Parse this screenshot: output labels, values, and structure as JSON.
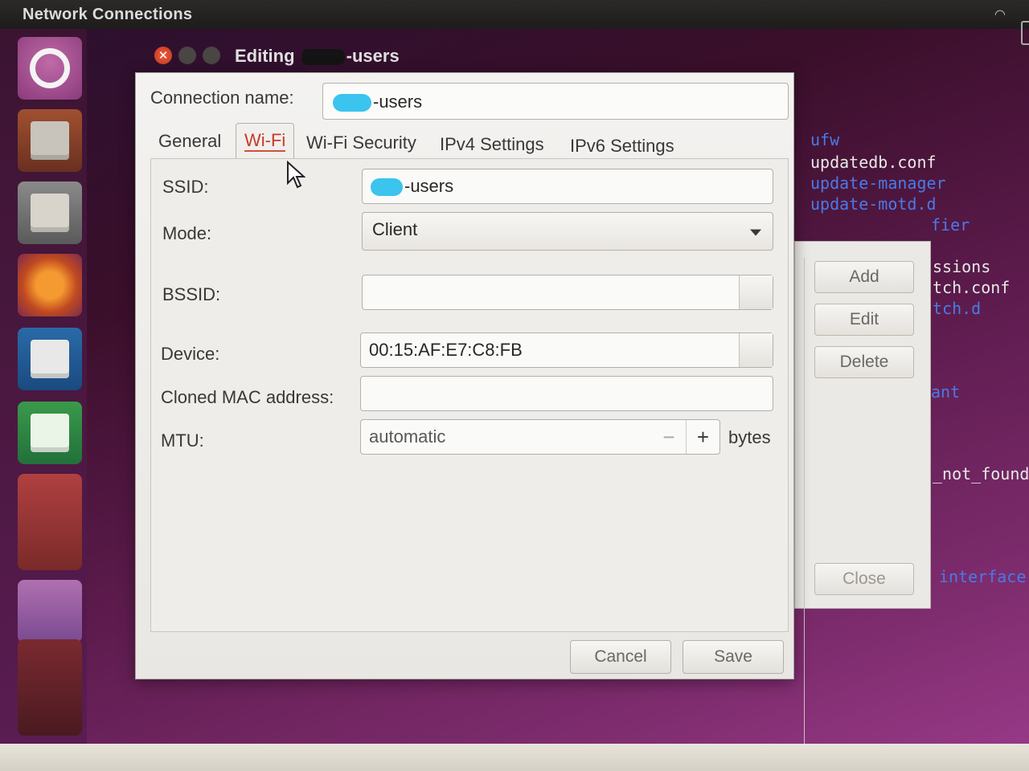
{
  "topbar": {
    "title": "Network Connections"
  },
  "terminal": {
    "lines": [
      {
        "text": "ufw",
        "color": "#4a7ae8"
      },
      {
        "text": "updatedb.conf",
        "color": "#e8e8e8"
      },
      {
        "text": "update-manager",
        "color": "#4a7ae8"
      },
      {
        "text": "update-motd.d",
        "color": "#4a7ae8"
      },
      {
        "text": "fier",
        "color": "#4a7ae8"
      },
      {
        "text": "ssions",
        "color": "#e8e8e8"
      },
      {
        "text": "tch.conf",
        "color": "#e8e8e8"
      },
      {
        "text": "tch.d",
        "color": "#4a7ae8"
      },
      {
        "text": "ant",
        "color": "#4a7ae8"
      },
      {
        "text": "_not_found",
        "color": "#e8e8e8"
      },
      {
        "text": "interface",
        "color": "#4a7ae8"
      }
    ]
  },
  "background_dialog": {
    "add": "Add",
    "edit": "Edit",
    "delete": "Delete",
    "close": "Close"
  },
  "dialog": {
    "title_prefix": "Editing",
    "title_suffix": "-users",
    "connection_name_label": "Connection name:",
    "connection_name_value": "-users",
    "tabs": [
      "General",
      "Wi-Fi",
      "Wi-Fi Security",
      "IPv4 Settings",
      "IPv6 Settings"
    ],
    "active_tab": "Wi-Fi",
    "ssid_label": "SSID:",
    "ssid_value": "-users",
    "mode_label": "Mode:",
    "mode_value": "Client",
    "bssid_label": "BSSID:",
    "bssid_value": "",
    "device_label": "Device:",
    "device_value": "00:15:AF:E7:C8:FB",
    "cloned_mac_label": "Cloned MAC address:",
    "cloned_mac_value": "",
    "mtu_label": "MTU:",
    "mtu_value": "automatic",
    "mtu_unit": "bytes",
    "cancel": "Cancel",
    "save": "Save"
  },
  "colors": {
    "accent_red": "#c83a2a",
    "terminal_blue": "#4a7ae8",
    "close_button": "#f05a3a"
  }
}
